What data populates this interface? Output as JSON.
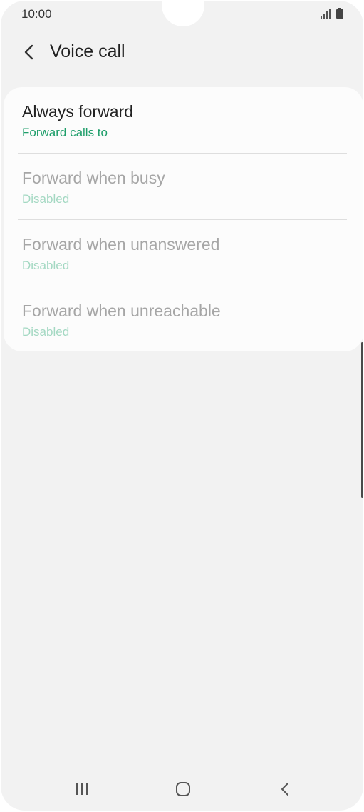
{
  "status_bar": {
    "time": "10:00",
    "icons": [
      "signal-icon",
      "battery-icon"
    ]
  },
  "header": {
    "back_icon": "chevron-left-icon",
    "title": "Voice call"
  },
  "forwarding_options": [
    {
      "label": "Always forward",
      "status": "Forward calls to",
      "enabled": true
    },
    {
      "label": "Forward when busy",
      "status": "Disabled",
      "enabled": false
    },
    {
      "label": "Forward when unanswered",
      "status": "Disabled",
      "enabled": false
    },
    {
      "label": "Forward when unreachable",
      "status": "Disabled",
      "enabled": false
    }
  ],
  "colors": {
    "accent": "#1e9e6a",
    "accent_disabled": "#a3d8c2",
    "background": "#f2f2f2",
    "card": "#fcfcfc"
  },
  "nav_bar": {
    "icons": [
      "recent-apps-icon",
      "home-icon",
      "back-icon"
    ]
  }
}
